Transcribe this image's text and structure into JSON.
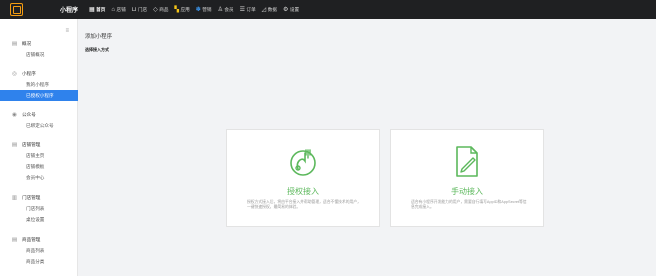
{
  "brand": {
    "name": "",
    "tagline": "",
    "store_label": "小程序",
    "accent": "#f39c12"
  },
  "nav": {
    "items": [
      {
        "label": "首页",
        "icon": "grid-icon",
        "active": true
      },
      {
        "label": "店铺",
        "icon": "home-icon"
      },
      {
        "label": "门店",
        "icon": "store-icon"
      },
      {
        "label": "商品",
        "icon": "tag-icon"
      },
      {
        "label": "应用",
        "icon": "apps-icon"
      },
      {
        "label": "营销",
        "icon": "marketing-icon"
      },
      {
        "label": "会员",
        "icon": "user-icon"
      },
      {
        "label": "订单",
        "icon": "order-icon"
      },
      {
        "label": "数据",
        "icon": "chart-icon"
      },
      {
        "label": "设置",
        "icon": "gear-icon"
      }
    ]
  },
  "sidebar": {
    "collapse_icon": "menu-collapse-icon",
    "groups": [
      {
        "title": "概况",
        "icon": "overview-icon",
        "items": [
          "店铺概况"
        ]
      },
      {
        "title": "小程序",
        "icon": "miniapp-icon",
        "items": [
          "我的小程序",
          "已授权小程序"
        ],
        "selected": "已授权小程序"
      },
      {
        "title": "公众号",
        "icon": "wechat-icon",
        "items": [
          "已绑定公众号"
        ]
      },
      {
        "title": "店铺管理",
        "icon": "shop-icon",
        "items": [
          "店铺主页",
          "店铺模板",
          "会员中心"
        ]
      },
      {
        "title": "门店管理",
        "icon": "store-manage-icon",
        "items": [
          "门店列表",
          "桌位设置"
        ]
      },
      {
        "title": "商品管理",
        "icon": "goods-icon",
        "items": [
          "商品列表",
          "商品分类"
        ]
      }
    ]
  },
  "main": {
    "title": "添加小程序",
    "subtitle": "选择接入方式",
    "cards": [
      {
        "title": "授权接入",
        "description": "授权方式接入后，将由平台接入并帮助管理，适合不懂技术的用户，一键快速授权，最简易的体验。",
        "icon": "authorize-hand-icon",
        "color": "#5cb85c"
      },
      {
        "title": "手动接入",
        "description": "适合有小程序开发能力的用户，需要自行填写AppID和AppSecret等信息完成接入。",
        "icon": "manual-document-icon",
        "color": "#5cb85c"
      }
    ]
  }
}
